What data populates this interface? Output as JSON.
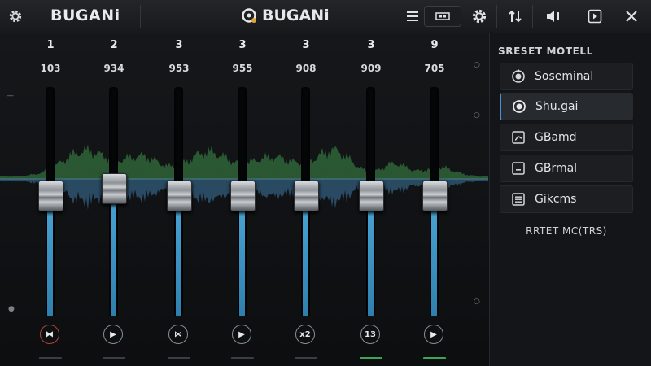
{
  "titlebar": {
    "brand_left": "BUGANi",
    "brand_center": "BUGANi",
    "buttons": [
      "menu",
      "display",
      "settings",
      "swap",
      "speaker",
      "play",
      "close"
    ]
  },
  "bands": [
    {
      "number": "1",
      "value": "103",
      "level": 0.53,
      "button": "⧓",
      "button_icon": "bowtie-icon",
      "button_red": true,
      "indicator_on": false
    },
    {
      "number": "2",
      "value": "934",
      "level": 0.56,
      "button": "▶",
      "button_icon": "play-icon",
      "button_red": false,
      "indicator_on": false
    },
    {
      "number": "3",
      "value": "953",
      "level": 0.53,
      "button": "⋈",
      "button_icon": "wave-symbol-icon",
      "button_red": false,
      "indicator_on": false
    },
    {
      "number": "3",
      "value": "955",
      "level": 0.53,
      "button": "▶",
      "button_icon": "play-icon",
      "button_red": false,
      "indicator_on": false
    },
    {
      "number": "3",
      "value": "908",
      "level": 0.53,
      "button": "x2",
      "button_icon": "x2-icon",
      "button_red": false,
      "indicator_on": false
    },
    {
      "number": "3",
      "value": "909",
      "level": 0.53,
      "button": "13",
      "button_icon": "thirteen-icon",
      "button_red": false,
      "indicator_on": true
    },
    {
      "number": "9",
      "value": "705",
      "level": 0.53,
      "button": "▶",
      "button_icon": "play-icon",
      "button_red": false,
      "indicator_on": true
    }
  ],
  "panel": {
    "title": "SRESET MOTELL",
    "presets": [
      {
        "label": "Soseminal",
        "icon": "radio-dial-icon",
        "active": false
      },
      {
        "label": "Shu.gai",
        "icon": "radio-selected-icon",
        "active": true
      },
      {
        "label": "GBamd",
        "icon": "curve-box-icon",
        "active": false
      },
      {
        "label": "GBrmal",
        "icon": "minus-box-icon",
        "active": false
      },
      {
        "label": "Gikcms",
        "icon": "list-box-icon",
        "active": false
      }
    ],
    "reset_label": "RRTET MC(TRS)"
  },
  "colors": {
    "accent_blue": "#4aa7d6",
    "wave_green": "#3e8f4a",
    "wave_blue": "#3a6f96",
    "indicator_green": "#3aa55a",
    "alert_red": "#b0453b"
  }
}
